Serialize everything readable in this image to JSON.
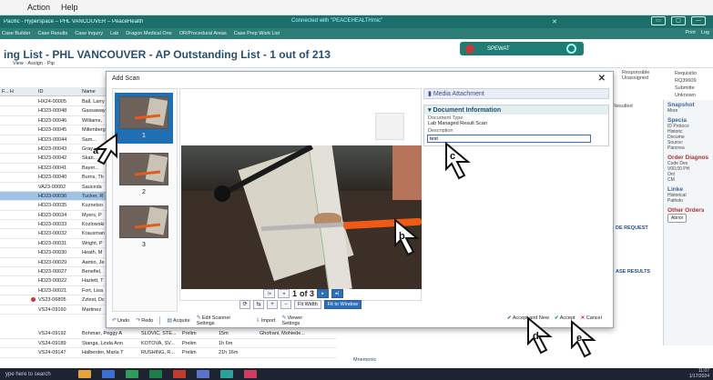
{
  "os_menu": {
    "items": [
      "Action",
      "Help"
    ]
  },
  "titlebar": {
    "title": "Pacific - Hyperspace – PHL VANCOUVER – PeaceHealth",
    "connected": "Connected with \"PEACEHEALTHmic\"",
    "buttons": [
      "▭",
      "▢",
      "—"
    ]
  },
  "epic_toolbar": {
    "items": [
      "Case Builder",
      "Case Results",
      "Case Inquiry",
      "Lab",
      "Dragon Medical One",
      "OR/Procedural Areas",
      "Case Prep Work List"
    ],
    "right": [
      "Print",
      "Log"
    ]
  },
  "worklist": {
    "title": "ing List - PHL VANCOUVER - AP Outstanding List - 1 out of 213",
    "toolbar": [
      "View",
      "Assign",
      "Pip"
    ],
    "spewat": "SPEWAT",
    "columns": [
      "F... H",
      "ID",
      "Name"
    ],
    "rows": [
      {
        "id": "HX24-00005",
        "name": "Ball, Larry"
      },
      {
        "id": "HD23-00048",
        "name": "Gassaway"
      },
      {
        "id": "HD23-00046",
        "name": "Williams,"
      },
      {
        "id": "HD23-00045",
        "name": "Miltenberg"
      },
      {
        "id": "HD23-00044",
        "name": "Sam..."
      },
      {
        "id": "HD23-00043",
        "name": "Gray..."
      },
      {
        "id": "HD23-00042",
        "name": "Skab..."
      },
      {
        "id": "HD23-00041",
        "name": "Bayer..."
      },
      {
        "id": "HD23-00040",
        "name": "Burns, Th"
      },
      {
        "id": "VA23-00002",
        "name": "Sauceda"
      },
      {
        "id": "HD23-00036",
        "name": "Tucker, R"
      },
      {
        "id": "HD23-00035",
        "name": "Kuznetso"
      },
      {
        "id": "HD23-00034",
        "name": "Myers, P"
      },
      {
        "id": "HD23-00033",
        "name": "Kozlowski"
      },
      {
        "id": "HD23-00032",
        "name": "Krausman"
      },
      {
        "id": "HD23-00031",
        "name": "Wright, P"
      },
      {
        "id": "HD23-00030",
        "name": "Heath, M"
      },
      {
        "id": "HD23-00029",
        "name": "Aamio, Je"
      },
      {
        "id": "HD23-00027",
        "name": "Benefiel, "
      },
      {
        "id": "HD23-00022",
        "name": "Hazlett, T"
      },
      {
        "id": "HD23-00021",
        "name": "Fort, Lisa"
      },
      {
        "id": "VS23-06805",
        "name": "Zztest, Dc"
      },
      {
        "id": "VS24-09160",
        "name": "Martinez"
      }
    ],
    "bottom_rows": [
      {
        "id": "VS24-09192",
        "name": "Bohman, Peggy A",
        "c3": "SLOVIC, STE...",
        "c4": "Prelim",
        "c5": "15m",
        "c6": "Ghofrani, Mohiede..."
      },
      {
        "id": "VS24-09189",
        "name": "Stanga, Linda Ann",
        "c3": "KOTOVA, SV...",
        "c4": "Prelim",
        "c5": "1h 6m",
        "c6": ""
      },
      {
        "id": "VS24-09147",
        "name": "Halberder, Marla T",
        "c3": "RUSHING, R...",
        "c4": "Prelim",
        "c5": "21h 16m",
        "c6": ""
      }
    ],
    "mnemonic": "Mnemonic"
  },
  "right_bg": {
    "responsible": "Responsible",
    "unassigned": "Unassigned",
    "requisition": "Requisitio",
    "req_no": "RQ39609",
    "submitter": "Submitte",
    "unknown": "Unknown",
    "resulted": "Resulted",
    "snapshot": "Snapshot",
    "more": "More",
    "special": "Specia",
    "protocol": "ID Protoco",
    "historic": "Historic",
    "docum": "Docume",
    "source": "Source:",
    "pancrea": "Pancrea",
    "orders": "Order Diagnos",
    "code": "Code  Des",
    "v00": "V00.00 PH",
    "onl": "Onl",
    "cm": "CM",
    "linked": "Linke",
    "historical": "Historical",
    "patholo": "Patholo",
    "other_orders": "Other Orders",
    "abnorm": "Abnor",
    "de_request": "DE REQUEST",
    "ase_results": "ASE RESULTS"
  },
  "dialog": {
    "title": "Add Scan",
    "thumbnails": [
      {
        "num": "1"
      },
      {
        "num": "2"
      },
      {
        "num": "3"
      }
    ],
    "pager": {
      "current": "1",
      "of_text": "of 3"
    },
    "zoom": {
      "fit_width": "Fit Width",
      "fit_window": "Fit to Window"
    },
    "toolbar": [
      "Undo",
      "Redo",
      "Acquire",
      "Edit Scanner Settings",
      "Import",
      "Viewer Settings"
    ],
    "actions": {
      "accept_new": "Accept and New",
      "accept": "Accept",
      "cancel": "Cancel"
    },
    "media": {
      "header": "Media Attachment",
      "section": "Document Information",
      "doc_type_label": "Document Type",
      "doc_type_value": "Lab Managed Result Scan",
      "description_label": "Description",
      "description_value": "test"
    }
  },
  "annotations": {
    "a": "a",
    "b": "b",
    "c": "c",
    "d": "d",
    "e": "e"
  },
  "taskbar": {
    "search": "ype here to search",
    "time": "11:07",
    "date": "1/17/2024"
  }
}
